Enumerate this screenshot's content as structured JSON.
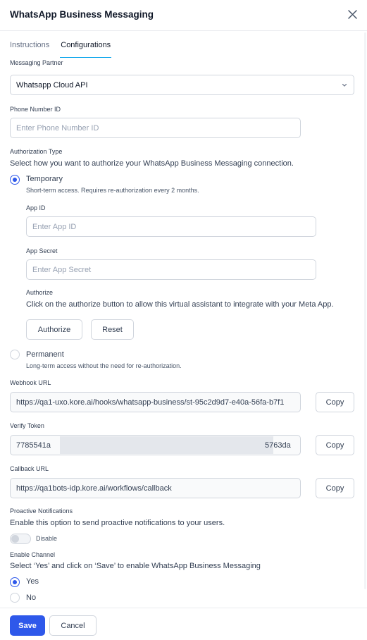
{
  "header": {
    "title": "WhatsApp Business Messaging",
    "close_icon": "close-icon"
  },
  "tabs": [
    {
      "label": "Instructions",
      "active": false
    },
    {
      "label": "Configurations",
      "active": true
    }
  ],
  "messaging_partner": {
    "label": "Messaging Partner",
    "selected": "Whatsapp Cloud API"
  },
  "phone_number_id": {
    "label": "Phone Number ID",
    "placeholder": "Enter Phone Number ID"
  },
  "authorization": {
    "label": "Authorization Type",
    "description": "Select how you want to authorize your WhatsApp Business Messaging connection.",
    "temporary": {
      "label": "Temporary",
      "help": "Short-term access. Requires re-authorization every 2 months.",
      "selected": true
    },
    "app_id": {
      "label": "App ID",
      "placeholder": "Enter App ID"
    },
    "app_secret": {
      "label": "App Secret",
      "placeholder": "Enter App Secret"
    },
    "authorize_section": {
      "label": "Authorize",
      "description": "Click on the authorize button to allow this virtual assistant to integrate with your Meta App.",
      "authorize_button": "Authorize",
      "reset_button": "Reset"
    },
    "permanent": {
      "label": "Permanent",
      "help": "Long-term access without the need for re-authorization.",
      "selected": false
    }
  },
  "webhook_url": {
    "label": "Webhook URL",
    "value": "https://qa1-uxo.kore.ai/hooks/whatsapp-business/st-95c2d9d7-e40a-56fa-b7f1",
    "copy": "Copy"
  },
  "verify_token": {
    "label": "Verify Token",
    "value_start": "7785541a",
    "value_end": "5763da",
    "copy": "Copy"
  },
  "callback_url": {
    "label": "Callback URL",
    "value": "https://qa1bots-idp.kore.ai/workflows/callback",
    "copy": "Copy"
  },
  "proactive": {
    "label": "Proactive Notifications",
    "description": "Enable this option to send proactive notifications to your users.",
    "toggle_label": "Disable",
    "enabled": false
  },
  "enable_channel": {
    "label": "Enable Channel",
    "description": "Select ‘Yes’ and click on ‘Save’ to enable WhatsApp Business Messaging",
    "options": [
      {
        "label": "Yes",
        "selected": true
      },
      {
        "label": "No",
        "selected": false
      }
    ]
  },
  "footer": {
    "save": "Save",
    "cancel": "Cancel"
  },
  "colors": {
    "primary": "#2e58ea",
    "tab_underline": "#0ba5ec",
    "border": "#d0d5dd"
  }
}
